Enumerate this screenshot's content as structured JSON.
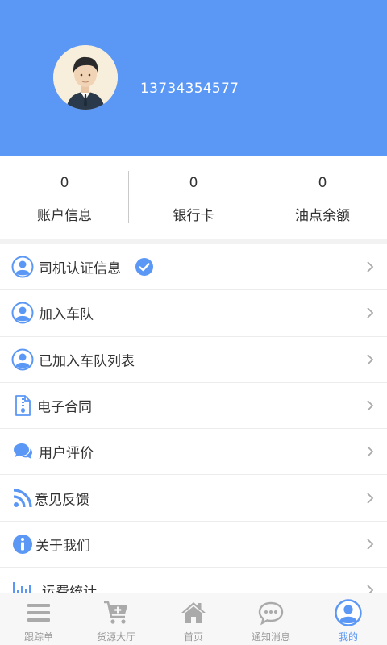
{
  "profile": {
    "phone": "13734354577"
  },
  "stats": [
    {
      "value": "0",
      "label": "账户信息"
    },
    {
      "value": "0",
      "label": "银行卡"
    },
    {
      "value": "0",
      "label": "油点余额"
    }
  ],
  "menu": {
    "items": [
      {
        "label": "司机认证信息",
        "icon": "user-circle-icon",
        "verified": true
      },
      {
        "label": "加入车队",
        "icon": "user-circle-icon"
      },
      {
        "label": "已加入车队列表",
        "icon": "user-circle-icon"
      },
      {
        "label": "电子合同",
        "icon": "contract-file-icon"
      },
      {
        "label": "用户评价",
        "icon": "chat-bubbles-icon"
      },
      {
        "label": "意见反馈",
        "icon": "rss-feedback-icon"
      },
      {
        "label": "关于我们",
        "icon": "info-icon"
      },
      {
        "label": "运费统计",
        "icon": "bar-chart-icon"
      }
    ]
  },
  "tabbar": {
    "tabs": [
      {
        "label": "跟踪单",
        "icon": "list-icon"
      },
      {
        "label": "货源大厅",
        "icon": "cart-plus-icon"
      },
      {
        "label": "首页",
        "icon": "home-icon"
      },
      {
        "label": "通知消息",
        "icon": "message-icon"
      },
      {
        "label": "我的",
        "icon": "user-circle-icon",
        "active": true
      }
    ]
  },
  "colors": {
    "primary": "#5b97f5",
    "inactive": "#aaaaaa",
    "text": "#333333"
  }
}
